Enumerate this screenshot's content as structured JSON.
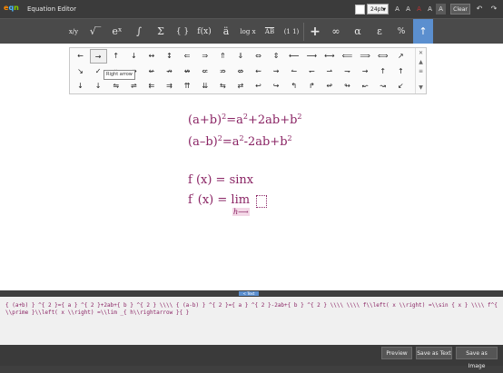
{
  "app": {
    "logo_e": "e",
    "logo_q": "q",
    "logo_n": "n",
    "title": "Equation Editor"
  },
  "toolbar": {
    "font_size": "24pt",
    "format_buttons": [
      "A",
      "A",
      "A",
      "A",
      "A"
    ],
    "clear": "Clear",
    "undo": "↶",
    "redo": "↷",
    "swatch_color": "#ffffff"
  },
  "symbols": [
    "x/y",
    "√‾",
    "eˣ",
    "∫",
    "Σ",
    "{ }",
    "f(x)",
    "ä",
    "log x",
    "AB",
    "(1 1)",
    "+",
    "∞",
    "α",
    "ε",
    "%",
    "↑"
  ],
  "palette": {
    "rows": [
      [
        "←",
        "→",
        "↑",
        "↓",
        "↔",
        "↕",
        "⇐",
        "⇒",
        "⇑",
        "⇓",
        "⇔",
        "⇕",
        "⟵",
        "⟶",
        "⟷",
        "⟸",
        "⟹",
        "⟺",
        "↗"
      ],
      [
        "↘",
        "✓",
        "↞",
        "↠",
        "↚",
        "↛",
        "↮",
        "⇍",
        "⇏",
        "⇎",
        "⇜",
        "⇝",
        "↼",
        "↽",
        "⇀",
        "⇁",
        "→",
        "↑",
        "↑"
      ],
      [
        "↓",
        "↓",
        "⇋",
        "⇌",
        "⇇",
        "⇉",
        "⇈",
        "⇊",
        "⇆",
        "⇄",
        "↩",
        "↪",
        "↰",
        "↱",
        "↫",
        "↬",
        "↜",
        "↝",
        "↙"
      ]
    ],
    "side": [
      "✕",
      "▲",
      "≡",
      "▼"
    ],
    "tooltip": "Right arrow"
  },
  "equations": {
    "l1_a": "(a+b)",
    "l1_e1": "2",
    "l1_b": "=a",
    "l1_e2": "2",
    "l1_c": "+2ab+b",
    "l1_e3": "2",
    "l2_a": "(a–b)",
    "l2_e1": "2",
    "l2_b": "=a",
    "l2_e2": "2",
    "l2_c": "-2ab+b",
    "l2_e3": "2",
    "l3": "f (x) = sinx",
    "l4_f": "f",
    "l4_prime": "′",
    "l4_rest": " (x) = lim",
    "l4_sub": "h⟶"
  },
  "divider_label": "< Text",
  "text_output": "{ (a+b) } ^{ 2 }={ a } ^{ 2 }+2ab+{ b } ^{ 2 } \\\\\\\\ { (a-b) } ^{ 2 }={ a } ^{ 2 }-2ab+{ b } ^{ 2 } \\\\\\\\ \\\\\\\\ f\\\\left( x \\\\right) =\\\\sin { x } \\\\\\\\ f^{ \\\\prime }\\\\left( x \\\\right) =\\\\lim _{ h\\\\rightarrow }{ }",
  "bottom": {
    "preview": "Preview",
    "save_text": "Save as Text",
    "save_image": "Save as Image"
  }
}
